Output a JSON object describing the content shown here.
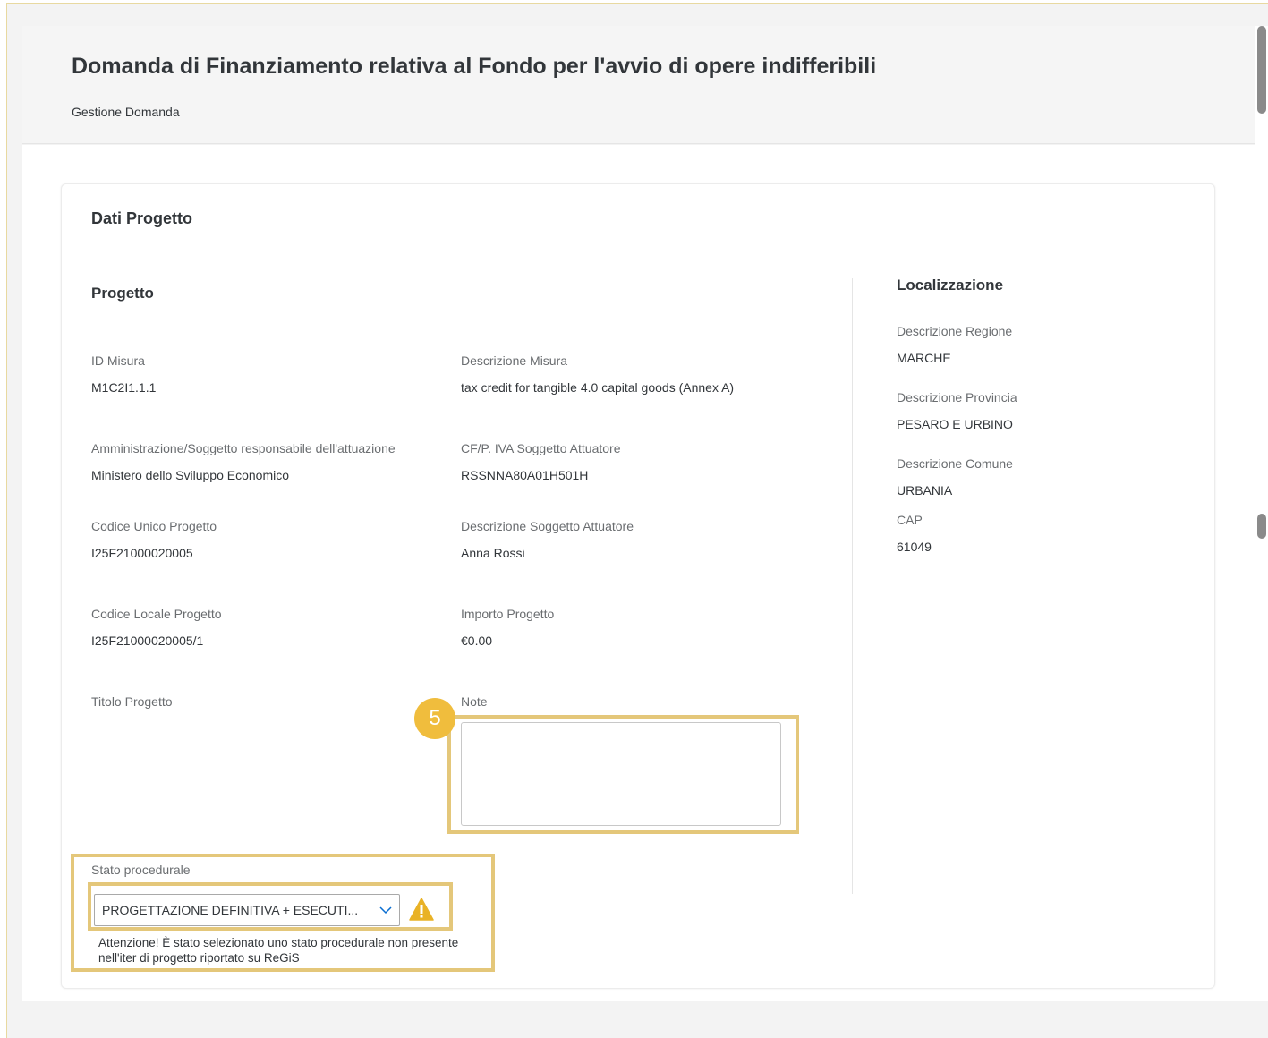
{
  "page": {
    "title": "Domanda di Finanziamento relativa al Fondo per l'avvio di opere indifferibili",
    "breadcrumb": "Gestione Domanda"
  },
  "card": {
    "title": "Dati Progetto",
    "progetto": {
      "title": "Progetto",
      "id_misura": {
        "label": "ID Misura",
        "value": "M1C2I1.1.1"
      },
      "descrizione_misura": {
        "label": "Descrizione Misura",
        "value": "tax credit for tangible 4.0 capital goods (Annex A)"
      },
      "amministrazione": {
        "label": "Amministrazione/Soggetto responsabile dell'attuazione",
        "value": "Ministero dello Sviluppo Economico"
      },
      "cf_piva": {
        "label": "CF/P. IVA Soggetto Attuatore",
        "value": "RSSNNA80A01H501H"
      },
      "codice_unico": {
        "label": "Codice Unico Progetto",
        "value": "I25F21000020005"
      },
      "descrizione_soggetto": {
        "label": "Descrizione Soggetto Attuatore",
        "value": "Anna Rossi"
      },
      "codice_locale": {
        "label": "Codice Locale Progetto",
        "value": "I25F21000020005/1"
      },
      "importo": {
        "label": "Importo Progetto",
        "value": "€0.00"
      },
      "titolo": {
        "label": "Titolo Progetto"
      },
      "note": {
        "label": "Note",
        "value": ""
      },
      "stato_procedurale": {
        "label": "Stato procedurale",
        "selected": "PROGETTAZIONE DEFINITIVA + ESECUTI...",
        "warning": "Attenzione! È stato selezionato uno stato procedurale non presente nell'iter di progetto riportato su ReGiS"
      }
    },
    "localizzazione": {
      "title": "Localizzazione",
      "regione": {
        "label": "Descrizione Regione",
        "value": "MARCHE"
      },
      "provincia": {
        "label": "Descrizione Provincia",
        "value": "PESARO E URBINO"
      },
      "comune": {
        "label": "Descrizione Comune",
        "value": "URBANIA"
      },
      "cap": {
        "label": "CAP",
        "value": "61049"
      }
    }
  },
  "annotation": {
    "step": "5"
  },
  "colors": {
    "highlight": "#e4c77a",
    "badge": "#f0bd3d",
    "warning": "#e9b226"
  },
  "icons": {
    "chevron": "chevron-down-icon",
    "warning": "warning-icon"
  }
}
